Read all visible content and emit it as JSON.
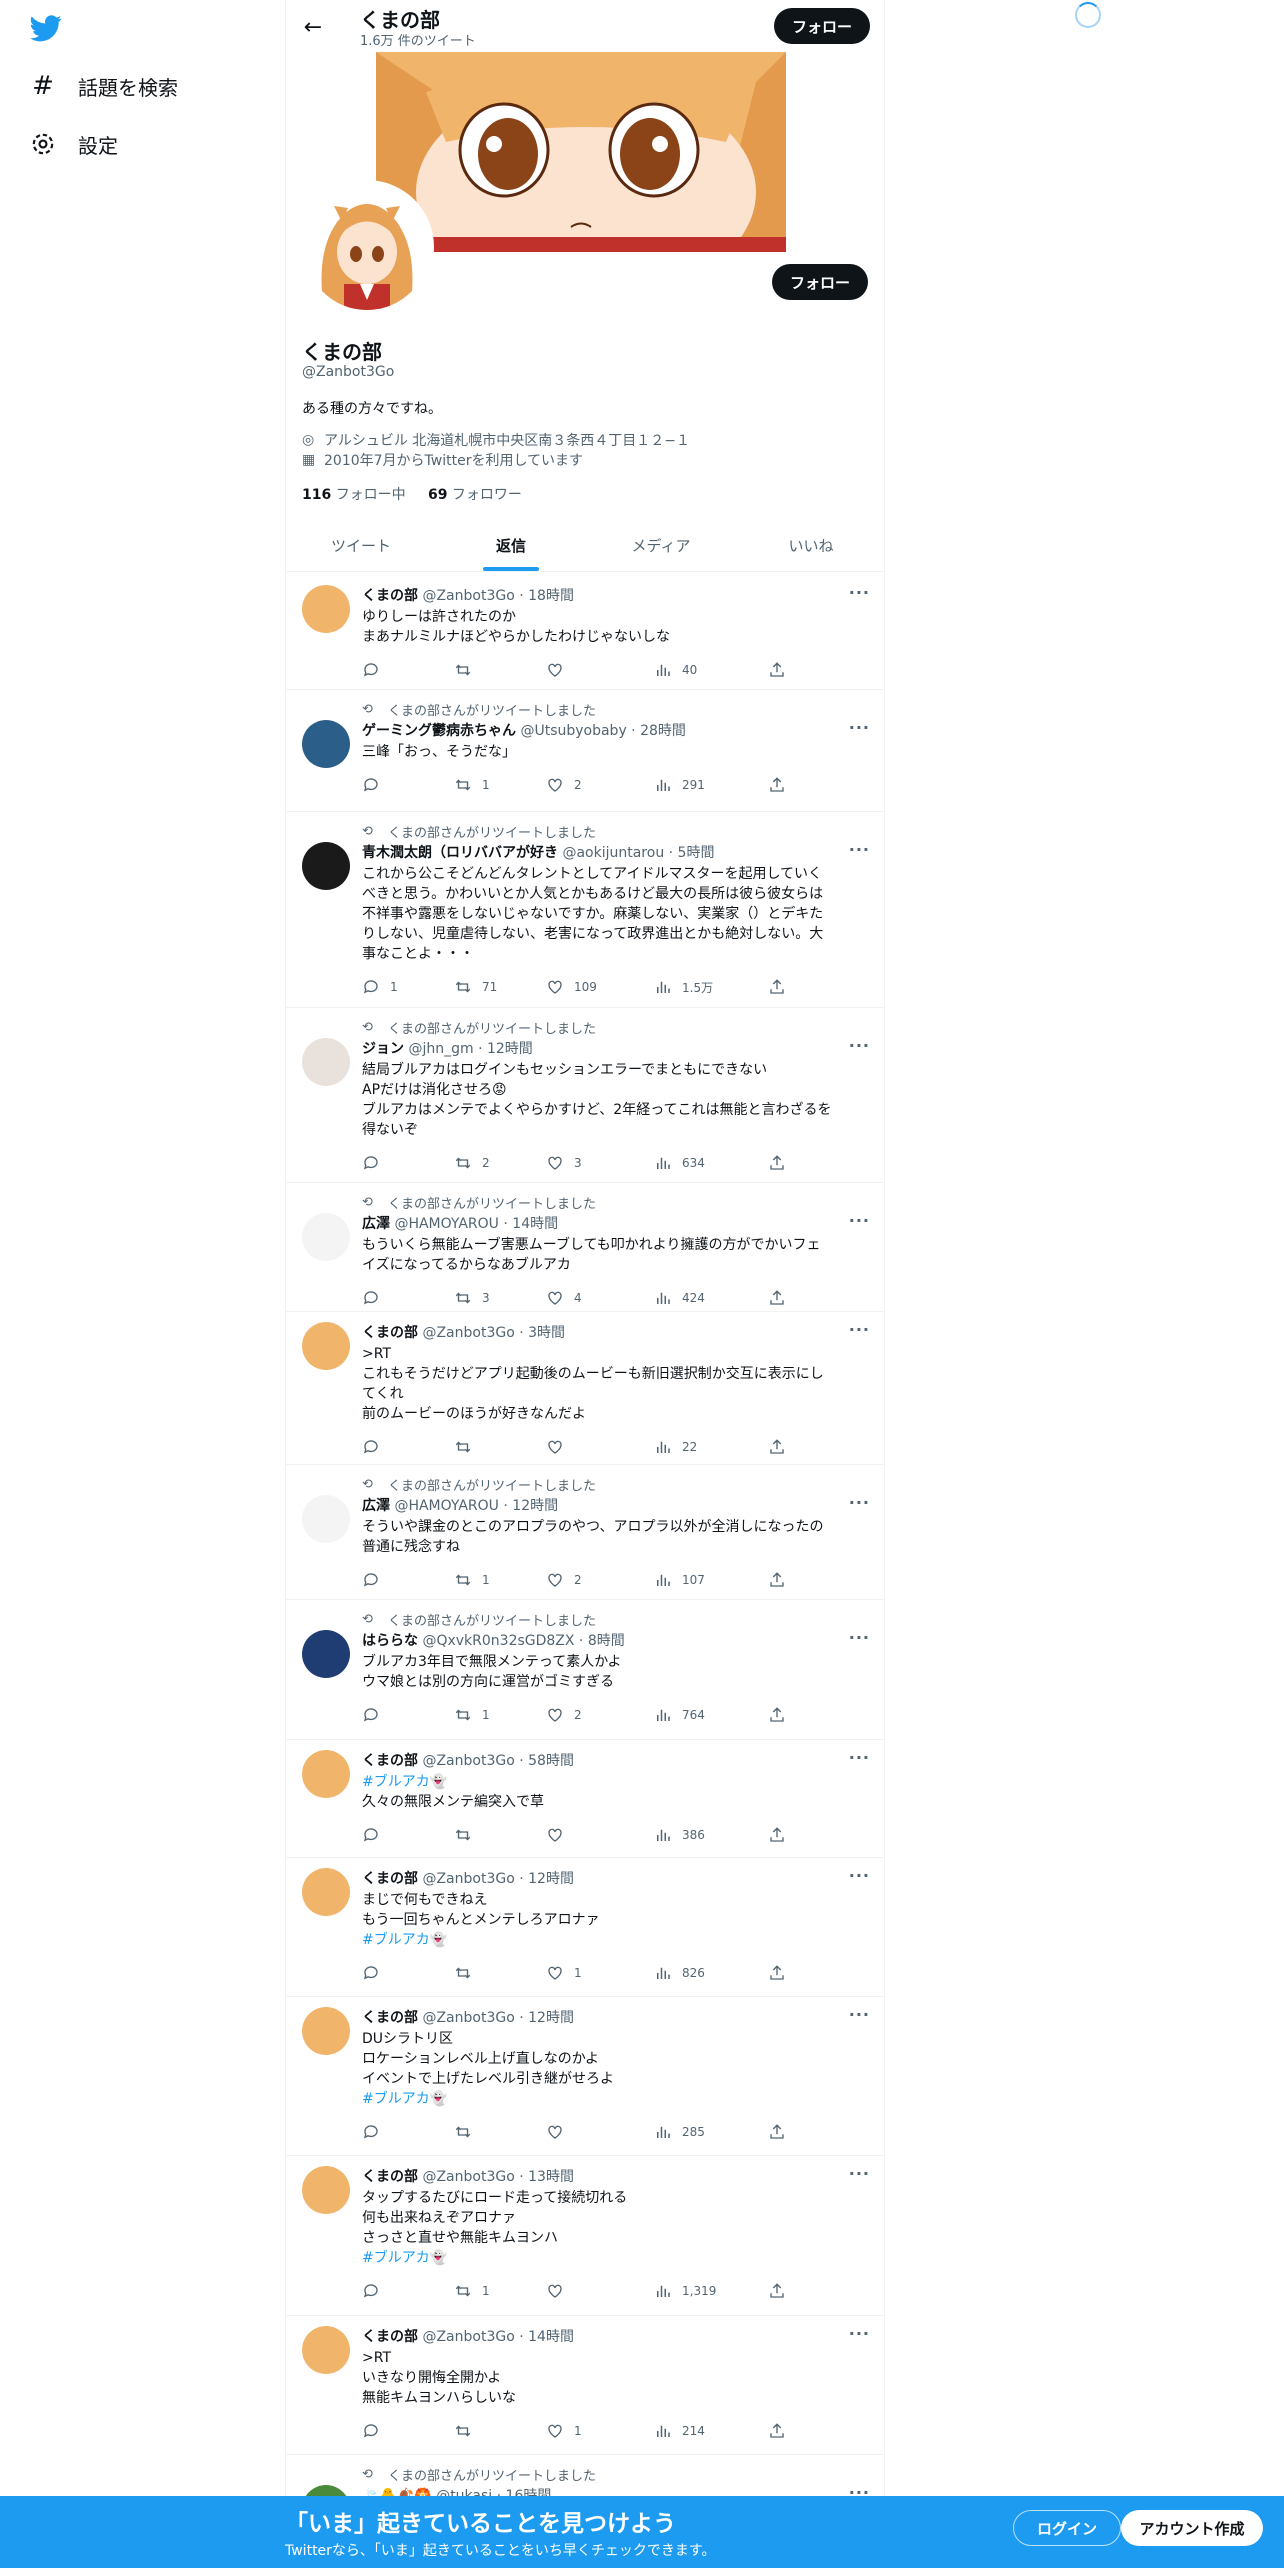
{
  "nav": {
    "explore_label": "話題を検索",
    "settings_label": "設定"
  },
  "header": {
    "name": "くまの部",
    "tweet_count": "1.6万 件のツイート",
    "follow_label": "フォロー"
  },
  "profile": {
    "name": "くまの部",
    "handle": "@Zanbot3Go",
    "bio": "ある種の方々ですね。",
    "location": "アルシュビル 北海道札幌市中央区南３条西４丁目１２−１",
    "joined": "2010年7月からTwitterを利用しています",
    "following_count": "116",
    "following_label": "フォロー中",
    "followers_count": "69",
    "followers_label": "フォロワー",
    "follow_label": "フォロー"
  },
  "tabs": [
    "ツイート",
    "返信",
    "メディア",
    "いいね"
  ],
  "tweets": [
    {
      "rt": "",
      "name": "くまの部",
      "handle": "@Zanbot3Go",
      "time": "18時間",
      "lines": [
        "ゆりしーは許されたのか",
        "まあナルミルナほどやらかしたわけじゃないしな"
      ],
      "reply": "",
      "retweet": "",
      "like": "",
      "view": "40"
    },
    {
      "rt": "くまの部さんがリツイートしました",
      "name": "ゲーミング鬱病赤ちゃん",
      "handle": "@Utsubyobaby",
      "time": "28時間",
      "lines": [
        "三峰「おっ、そうだな」"
      ],
      "reply": "",
      "retweet": "1",
      "like": "2",
      "view": "291"
    },
    {
      "rt": "くまの部さんがリツイートしました",
      "name": "青木潤太朗（ロリババアが好き",
      "handle": "@aokijuntarou",
      "time": "5時間",
      "lines": [
        "これから公こそどんどんタレントとしてアイドルマスターを起用していく",
        "べきと思う。かわいいとか人気とかもあるけど最大の長所は彼ら彼女らは",
        "不祥事や露悪をしないじゃないですか。麻薬しない、実業家（）とデキた",
        "りしない、児童虐待しない、老害になって政界進出とかも絶対しない。大",
        "事なことよ・・・"
      ],
      "reply": "1",
      "retweet": "71",
      "like": "109",
      "view": "1.5万"
    },
    {
      "rt": "くまの部さんがリツイートしました",
      "name": "ジョン",
      "handle": "@jhn_gm",
      "time": "12時間",
      "lines": [
        "結局ブルアカはログインもセッションエラーでまともにできない",
        "APだけは消化させろ😡",
        "ブルアカはメンテでよくやらかすけど、2年経ってこれは無能と言わざるを",
        "得ないぞ"
      ],
      "reply": "",
      "retweet": "2",
      "like": "3",
      "view": "634"
    },
    {
      "rt": "くまの部さんがリツイートしました",
      "name": "広澤",
      "handle": "@HAMOYAROU",
      "time": "14時間",
      "lines": [
        "もういくら無能ムーブ害悪ムーブしても叩かれより擁護の方がでかいフェ",
        "イズになってるからなあブルアカ"
      ],
      "reply": "",
      "retweet": "3",
      "like": "4",
      "view": "424"
    },
    {
      "rt": "",
      "name": "くまの部",
      "handle": "@Zanbot3Go",
      "time": "3時間",
      "lines": [
        ">RT",
        "これもそうだけどアプリ起動後のムービーも新旧選択制か交互に表示にし",
        "てくれ",
        "前のムービーのほうが好きなんだよ"
      ],
      "reply": "",
      "retweet": "",
      "like": "",
      "view": "22"
    },
    {
      "rt": "くまの部さんがリツイートしました",
      "name": "広澤",
      "handle": "@HAMOYAROU",
      "time": "12時間",
      "lines": [
        "そういや課金のとこのアロプラのやつ、アロプラ以外が全消しになったの",
        "普通に残念すね"
      ],
      "reply": "",
      "retweet": "1",
      "like": "2",
      "view": "107"
    },
    {
      "rt": "くまの部さんがリツイートしました",
      "name": "はららな",
      "handle": "@QxvkR0n32sGD8ZX",
      "time": "8時間",
      "lines": [
        "ブルアカ3年目で無限メンテって素人かよ",
        "ウマ娘とは別の方向に運営がゴミすぎる"
      ],
      "reply": "",
      "retweet": "1",
      "like": "2",
      "view": "764"
    },
    {
      "rt": "",
      "name": "くまの部",
      "handle": "@Zanbot3Go",
      "time": "58時間",
      "lines": [
        "#ブルアカ👻",
        "久々の無限メンテ編突入で草"
      ],
      "reply": "",
      "retweet": "",
      "like": "",
      "view": "386"
    },
    {
      "rt": "",
      "name": "くまの部",
      "handle": "@Zanbot3Go",
      "time": "12時間",
      "lines": [
        "まじで何もできねえ",
        "もう一回ちゃんとメンテしろアロナァ",
        "#ブルアカ👻"
      ],
      "reply": "",
      "retweet": "",
      "like": "1",
      "view": "826"
    },
    {
      "rt": "",
      "name": "くまの部",
      "handle": "@Zanbot3Go",
      "time": "12時間",
      "lines": [
        "DUシラトリ区",
        "ロケーションレベル上げ直しなのかよ",
        "イベントで上げたレベル引き継がせろよ",
        "#ブルアカ👻"
      ],
      "reply": "",
      "retweet": "",
      "like": "",
      "view": "285"
    },
    {
      "rt": "",
      "name": "くまの部",
      "handle": "@Zanbot3Go",
      "time": "13時間",
      "lines": [
        "タップするたびにロード走って接続切れる",
        "何も出来ねえぞアロナァ",
        "さっさと直せや無能キムヨンハ",
        "#ブルアカ👻"
      ],
      "reply": "",
      "retweet": "1",
      "like": "",
      "view": "1,319"
    },
    {
      "rt": "",
      "name": "くまの部",
      "handle": "@Zanbot3Go",
      "time": "14時間",
      "lines": [
        ">RT",
        "いきなり開悔全開かよ",
        "無能キムヨンハらしいな"
      ],
      "reply": "",
      "retweet": "",
      "like": "1",
      "view": "214"
    },
    {
      "rt": "くまの部さんがリツイートしました",
      "name": "🍃🐥🍂🏵️",
      "handle": "@tukasi",
      "time": "16時間",
      "lines": [],
      "reply": "",
      "retweet": "",
      "like": "",
      "view": ""
    }
  ],
  "bottom": {
    "title": "「いま」起きていることを見つけよう",
    "subtitle": "Twitterなら、「いま」起きていることをいち早くチェックできます。",
    "login": "ログイン",
    "signup": "アカウント作成"
  },
  "colors": {
    "accent": "#1d9bf0",
    "text": "#0f1419",
    "muted": "#536471"
  },
  "icons": [
    "twitter-logo-icon",
    "hash-icon",
    "gear-icon",
    "back-arrow-icon",
    "location-icon",
    "calendar-icon",
    "reply-icon",
    "retweet-icon",
    "like-icon",
    "views-icon",
    "share-icon",
    "more-icon"
  ]
}
